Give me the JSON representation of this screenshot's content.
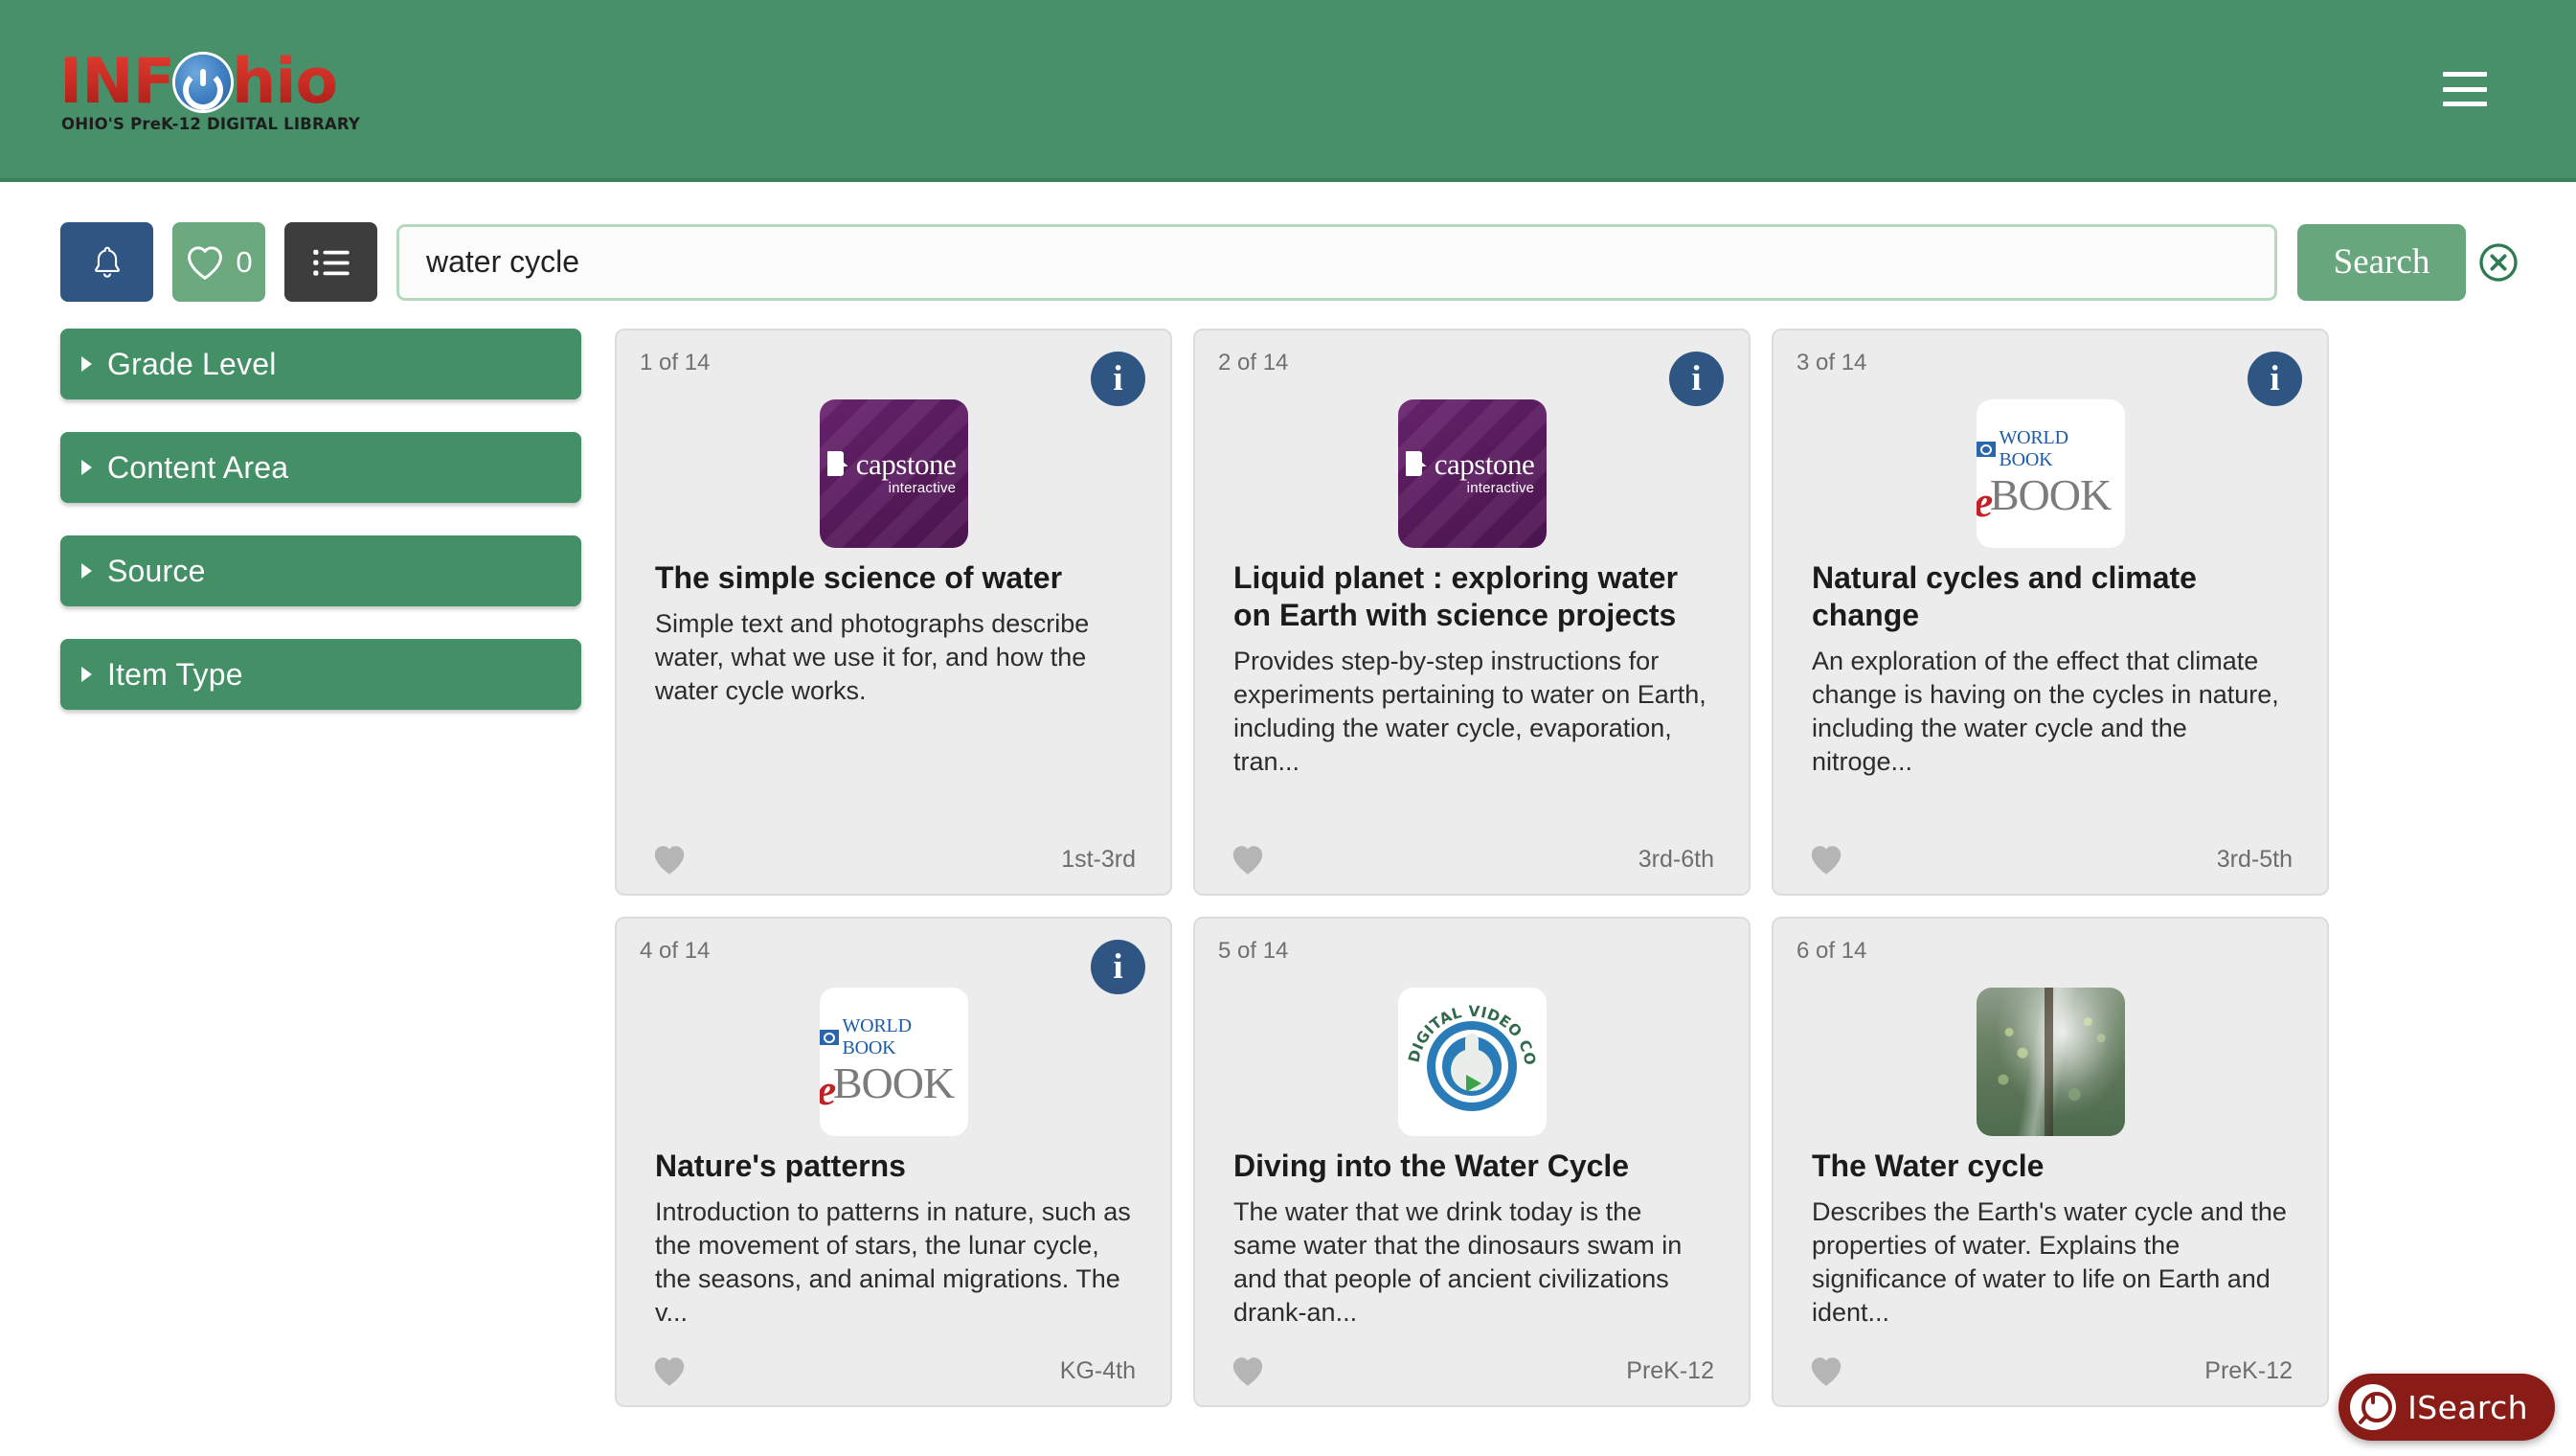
{
  "header": {
    "logo_text_1": "INF",
    "logo_text_2": "hio",
    "logo_tagline": "OHIO'S PreK-12 DIGITAL LIBRARY",
    "menu_icon": "hamburger-menu-icon",
    "background_color": "#479069"
  },
  "toolbar": {
    "alerts_label": "",
    "alerts_icon": "bell-icon",
    "favorites_count": "0",
    "favorites_icon": "heart-icon",
    "list_icon": "list-icon",
    "search_value": "water cycle",
    "search_placeholder": "Search",
    "search_button_label": "Search",
    "clear_icon": "clear-circle-x-icon",
    "accent_green": "#68a77d",
    "alert_blue": "#2f5583"
  },
  "facets": {
    "items": [
      {
        "label": "Grade Level"
      },
      {
        "label": "Content Area"
      },
      {
        "label": "Source"
      },
      {
        "label": "Item Type"
      }
    ]
  },
  "results": {
    "total": "14",
    "cards": [
      {
        "index_label": "1 of 14",
        "has_info": true,
        "info_label": "i",
        "thumb_type": "capstone",
        "thumb_alt": "capstone interactive",
        "title": "The simple science of water",
        "description": "Simple text and photographs describe water, what we use it for, and how the water cycle works.",
        "grade": "1st-3rd",
        "favorite_icon": "heart-icon"
      },
      {
        "index_label": "2 of 14",
        "has_info": true,
        "info_label": "i",
        "thumb_type": "capstone",
        "thumb_alt": "capstone interactive",
        "title": "Liquid planet : exploring water on Earth with science projects",
        "description": "Provides step-by-step instructions for experiments pertaining to water on Earth, including the water cycle, evaporation, tran...",
        "grade": "3rd-6th",
        "favorite_icon": "heart-icon"
      },
      {
        "index_label": "3 of 14",
        "has_info": true,
        "info_label": "i",
        "thumb_type": "worldbook",
        "thumb_alt": "World Book eBOOK",
        "title": "Natural cycles and climate change",
        "description": "An exploration of the effect that climate change is having on the cycles in nature, including the water cycle and the nitroge...",
        "grade": "3rd-5th",
        "favorite_icon": "heart-icon"
      },
      {
        "index_label": "4 of 14",
        "has_info": true,
        "info_label": "i",
        "thumb_type": "worldbook",
        "thumb_alt": "World Book eBOOK",
        "title": "Nature's patterns",
        "description": "Introduction to patterns in nature, such as the movement of stars, the lunar cycle, the seasons, and animal migrations. The v...",
        "grade": "KG-4th",
        "favorite_icon": "heart-icon"
      },
      {
        "index_label": "5 of 14",
        "has_info": false,
        "info_label": "",
        "thumb_type": "dvc",
        "thumb_alt": "Digital Video Collection",
        "title": "Diving into the Water Cycle",
        "description": "The water that we drink today is the same water that the dinosaurs swam in and that people of ancient civilizations drank-an...",
        "grade": "PreK-12",
        "favorite_icon": "heart-icon"
      },
      {
        "index_label": "6 of 14",
        "has_info": false,
        "info_label": "",
        "thumb_type": "photo",
        "thumb_alt": "forest sunlight photograph",
        "title": "The Water cycle",
        "description": "Describes the Earth's water cycle and the properties of water. Explains the significance of water to life on Earth and ident...",
        "grade": "PreK-12",
        "favorite_icon": "heart-icon"
      }
    ],
    "thumb_logos": {
      "capstone_word": "capstone",
      "capstone_sub": "interactive",
      "worldbook_top": "WORLD BOOK",
      "worldbook_e": "e",
      "worldbook_book": "BOOK",
      "dvc_text": "DIGITAL VIDEO COLLECTION"
    }
  },
  "isearch": {
    "label": "ISearch",
    "icon": "isearch-power-magnifier-icon",
    "color": "#8a1c17"
  }
}
